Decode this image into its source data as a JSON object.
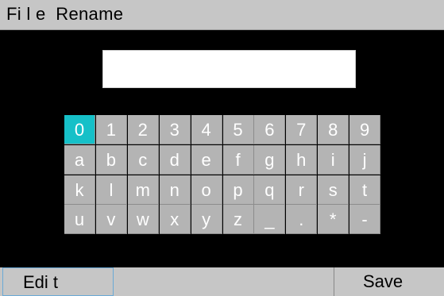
{
  "title": "Fi l e  Rename",
  "input": {
    "value": ""
  },
  "keyboard": {
    "selected": "0",
    "rows": [
      [
        "0",
        "1",
        "2",
        "3",
        "4",
        "5",
        "6",
        "7",
        "8",
        "9"
      ],
      [
        "a",
        "b",
        "c",
        "d",
        "e",
        "f",
        "g",
        "h",
        "i",
        "j"
      ],
      [
        "k",
        "l",
        "m",
        "n",
        "o",
        "p",
        "q",
        "r",
        "s",
        "t"
      ],
      [
        "u",
        "v",
        "w",
        "x",
        "y",
        "z",
        "_",
        ".",
        "*",
        "-"
      ]
    ],
    "colors": {
      "key": "#b4b4b4",
      "selected": "#16c0c8"
    }
  },
  "softkeys": {
    "edit": "Edi t",
    "save": "Save"
  }
}
